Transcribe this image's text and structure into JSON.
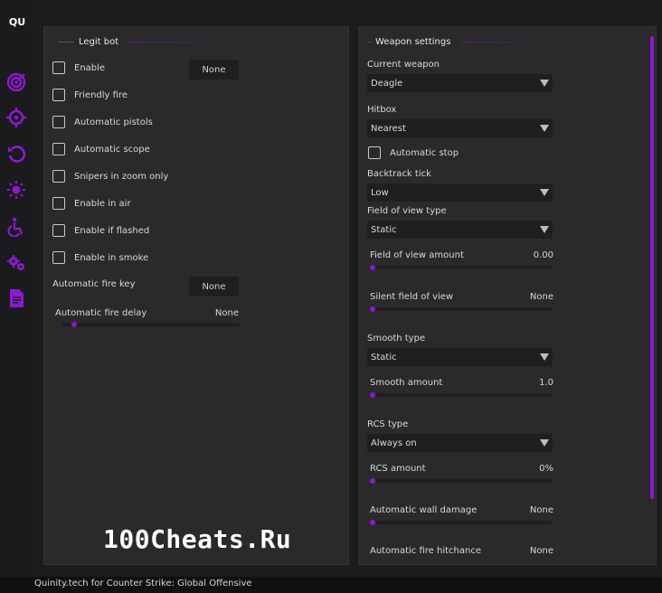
{
  "app": {
    "logo": "QU",
    "status": "Quinity.tech for Counter Strike: Global Offensive"
  },
  "colors": {
    "accent": "#8a1ad1",
    "panel": "#2a2a2b",
    "control": "#1f1f20"
  },
  "sidebar": {
    "icons": [
      {
        "name": "target-icon"
      },
      {
        "name": "crosshair-icon"
      },
      {
        "name": "reload-icon"
      },
      {
        "name": "sun-icon"
      },
      {
        "name": "wheelchair-icon"
      },
      {
        "name": "gears-icon"
      },
      {
        "name": "document-icon"
      }
    ]
  },
  "legit": {
    "title": "Legit bot",
    "enable_key": "None",
    "checkboxes": [
      {
        "label": "Enable",
        "checked": false
      },
      {
        "label": "Friendly fire",
        "checked": false
      },
      {
        "label": "Automatic pistols",
        "checked": false
      },
      {
        "label": "Automatic scope",
        "checked": false
      },
      {
        "label": "Snipers in zoom only",
        "checked": false
      },
      {
        "label": "Enable in air",
        "checked": false
      },
      {
        "label": "Enable if flashed",
        "checked": false
      },
      {
        "label": "Enable in smoke",
        "checked": false
      }
    ],
    "fire_key_label": "Automatic fire key",
    "fire_key_value": "None",
    "fire_delay_label": "Automatic fire delay",
    "fire_delay_value": "None",
    "fire_delay_level": 0.05
  },
  "weapon": {
    "title": "Weapon settings",
    "current_weapon_label": "Current weapon",
    "current_weapon_value": "Deagle",
    "hitbox_label": "Hitbox",
    "hitbox_value": "Nearest",
    "auto_stop_label": "Automatic stop",
    "auto_stop_checked": false,
    "backtrack_label": "Backtrack tick",
    "backtrack_value": "Low",
    "fov_type_label": "Field of view type",
    "fov_type_value": "Static",
    "fov_amount_label": "Field of view amount",
    "fov_amount_value": "0.00",
    "fov_amount_level": 0.0,
    "silent_fov_label": "Silent field of view",
    "silent_fov_value": "None",
    "silent_fov_level": 0.0,
    "smooth_type_label": "Smooth type",
    "smooth_type_value": "Static",
    "smooth_amount_label": "Smooth amount",
    "smooth_amount_value": "1.0",
    "smooth_amount_level": 0.0,
    "rcs_type_label": "RCS type",
    "rcs_type_value": "Always on",
    "rcs_amount_label": "RCS amount",
    "rcs_amount_value": "0%",
    "rcs_amount_level": 0.0,
    "wall_damage_label": "Automatic wall damage",
    "wall_damage_value": "None",
    "wall_damage_level": 0.0,
    "hitchance_label": "Automatic fire hitchance",
    "hitchance_value": "None"
  },
  "watermark": "100Cheats.Ru"
}
